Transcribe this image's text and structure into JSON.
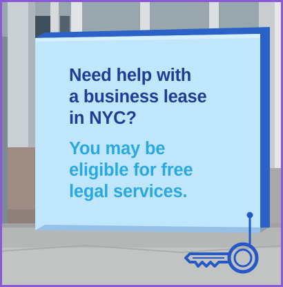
{
  "poster": {
    "headline": "Need help with\na business lease\nin NYC?",
    "subline": "You may be\neligible for free\nlegal services."
  },
  "colors": {
    "frame_border": "#8a5ad6",
    "card_face": "#bfe6fb",
    "card_side": "#2b62c8",
    "headline": "#1f3c96",
    "subline": "#2aa9de",
    "key": "#2458c6"
  },
  "icons": [
    "key-icon"
  ]
}
